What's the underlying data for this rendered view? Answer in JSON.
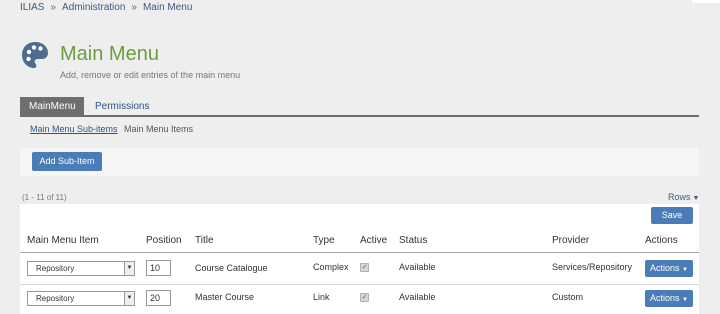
{
  "breadcrumb": {
    "items": [
      "ILIAS",
      "Administration",
      "Main Menu"
    ],
    "separator": "»"
  },
  "header": {
    "title": "Main Menu",
    "description": "Add, remove or edit entries of the main menu",
    "icon": "palette-icon"
  },
  "tabs": [
    {
      "label": "MainMenu",
      "active": true
    },
    {
      "label": "Permissions",
      "active": false
    }
  ],
  "subtabs": [
    {
      "label": "Main Menu Sub-items",
      "active": false
    },
    {
      "label": "Main Menu Items",
      "active": true
    }
  ],
  "toolbar": {
    "add_label": "Add Sub-Item"
  },
  "table": {
    "count": "(1 - 11 of 11)",
    "rows_label": "Rows",
    "save_label": "Save",
    "columns": [
      "Main Menu Item",
      "Position",
      "Title",
      "Type",
      "Active",
      "Status",
      "Provider",
      "Actions"
    ],
    "rows": [
      {
        "item": "Repository",
        "position": "10",
        "title": "Course Catalogue",
        "type": "Complex",
        "active": true,
        "status": "Available",
        "provider": "Services/Repository",
        "actions_label": "Actions"
      },
      {
        "item": "Repository",
        "position": "20",
        "title": "Master Course",
        "type": "Link",
        "active": true,
        "status": "Available",
        "provider": "Custom",
        "actions_label": "Actions"
      }
    ]
  },
  "colors": {
    "title_green": "#6c9d3e",
    "button_blue": "#4a7db8",
    "link_blue": "#2d5286",
    "tab_active": "#6e6e6e"
  }
}
